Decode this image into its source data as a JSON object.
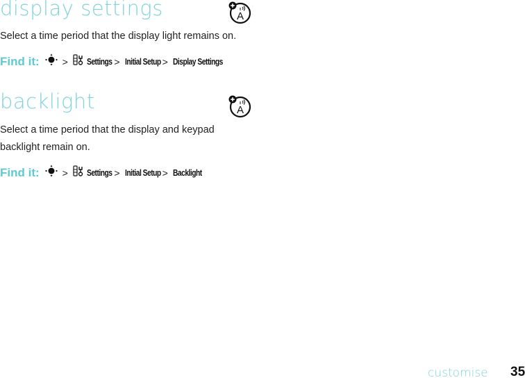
{
  "sections": [
    {
      "heading": "display settings",
      "paragraph": "Select a time period that the display light remains on.",
      "find_it": {
        "label": "Find it:",
        "nav_icon": "nav-key-icon",
        "separator": ">",
        "settings_icon": "settings-icon",
        "path": [
          "Settings",
          "Initial Setup",
          "Display Settings"
        ]
      },
      "feature_icon": "network-feature-icon"
    },
    {
      "heading": "backlight",
      "paragraph": "Select a time period that the display and keypad backlight remain on.",
      "find_it": {
        "label": "Find it:",
        "nav_icon": "nav-key-icon",
        "separator": ">",
        "settings_icon": "settings-icon",
        "path": [
          "Settings",
          "Initial Setup",
          "Backlight"
        ]
      },
      "feature_icon": "network-feature-icon"
    }
  ],
  "footer": {
    "section_name": "customise",
    "page_number": "35"
  },
  "colors": {
    "heading": "#7fd3d9",
    "find_it_label": "#5fcad3",
    "body_text": "#222222"
  }
}
